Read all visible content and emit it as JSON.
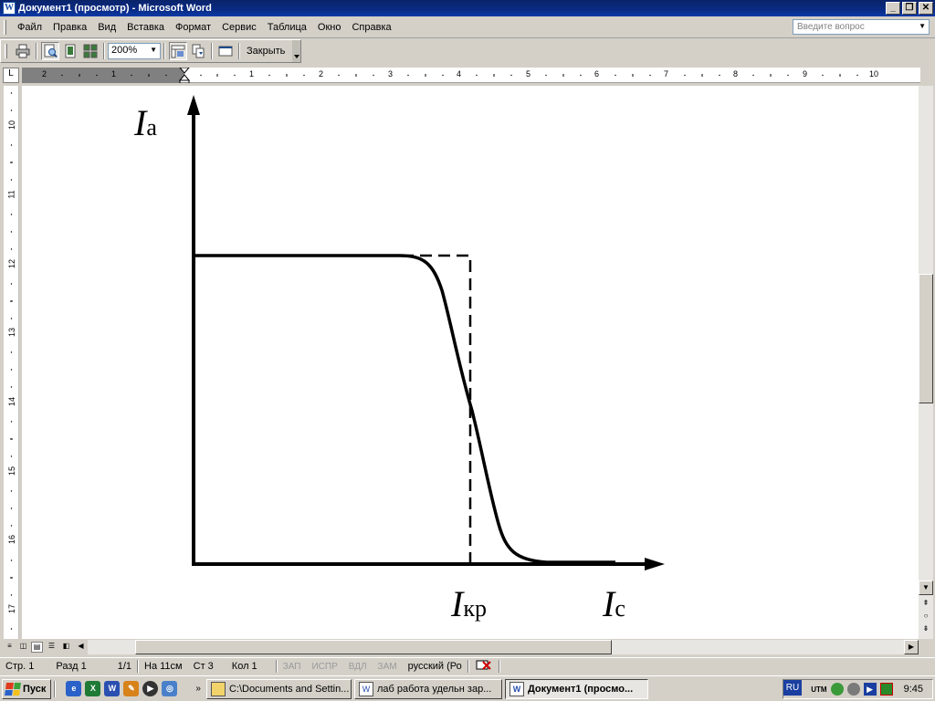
{
  "window": {
    "title": "Документ1 (просмотр) - Microsoft Word",
    "app_icon": "W",
    "buttons": [
      "_",
      "❐",
      "✕"
    ]
  },
  "menu": [
    "Файл",
    "Правка",
    "Вид",
    "Вставка",
    "Формат",
    "Сервис",
    "Таблица",
    "Окно",
    "Справка"
  ],
  "ask_placeholder": "Введите вопрос",
  "toolbar": {
    "zoom": "200%",
    "close_label": "Закрыть"
  },
  "ruler": {
    "corner": "L",
    "h_left": [
      "2",
      "1"
    ],
    "h_right": [
      "1",
      "2",
      "3",
      "4",
      "5",
      "6",
      "7",
      "8",
      "9",
      "10"
    ],
    "v": [
      "10",
      "11",
      "12",
      "13",
      "14",
      "15",
      "16",
      "17"
    ]
  },
  "figure": {
    "y_label_main": "I",
    "y_label_sub": "а",
    "x_label_main": "I",
    "x_label_sub": "с",
    "crit_label_main": "I",
    "crit_label_sub": "кр"
  },
  "status": {
    "page": "Стр. 1",
    "section": "Разд 1",
    "pages": "1/1",
    "at": "На 11см",
    "line": "Ст 3",
    "col": "Кол 1",
    "rec": "ЗАП",
    "trk": "ИСПР",
    "ext": "ВДЛ",
    "ovr": "ЗАМ",
    "language": "русский (Ро"
  },
  "taskbar": {
    "start": "Пуск",
    "tasks": [
      {
        "label": "C:\\Documents and Settin...",
        "icon": "folder-icon"
      },
      {
        "label": "лаб работа удельн зар...",
        "icon": "word-icon"
      },
      {
        "label": "Документ1 (просмо...",
        "icon": "word-icon",
        "active": true
      }
    ],
    "lang": "RU",
    "clock": "9:45"
  }
}
